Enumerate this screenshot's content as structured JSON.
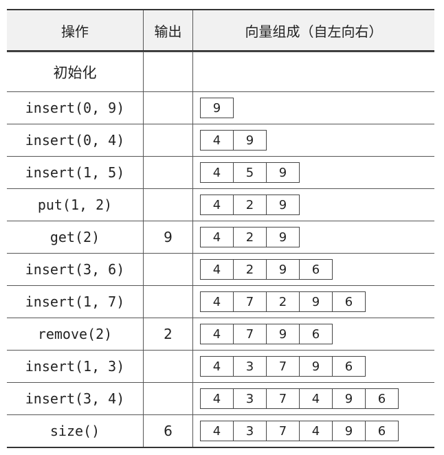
{
  "header": {
    "op": "操作",
    "output": "输出",
    "vector": "向量组成（自左向右）"
  },
  "rows": [
    {
      "op": "初始化",
      "output": "",
      "vector": []
    },
    {
      "op": "insert(0, 9)",
      "output": "",
      "vector": [
        "9"
      ]
    },
    {
      "op": "insert(0, 4)",
      "output": "",
      "vector": [
        "4",
        "9"
      ]
    },
    {
      "op": "insert(1, 5)",
      "output": "",
      "vector": [
        "4",
        "5",
        "9"
      ]
    },
    {
      "op": "put(1, 2)",
      "output": "",
      "vector": [
        "4",
        "2",
        "9"
      ]
    },
    {
      "op": "get(2)",
      "output": "9",
      "vector": [
        "4",
        "2",
        "9"
      ]
    },
    {
      "op": "insert(3, 6)",
      "output": "",
      "vector": [
        "4",
        "2",
        "9",
        "6"
      ]
    },
    {
      "op": "insert(1, 7)",
      "output": "",
      "vector": [
        "4",
        "7",
        "2",
        "9",
        "6"
      ]
    },
    {
      "op": "remove(2)",
      "output": "2",
      "vector": [
        "4",
        "7",
        "9",
        "6"
      ]
    },
    {
      "op": "insert(1, 3)",
      "output": "",
      "vector": [
        "4",
        "3",
        "7",
        "9",
        "6"
      ]
    },
    {
      "op": "insert(3, 4)",
      "output": "",
      "vector": [
        "4",
        "3",
        "7",
        "4",
        "9",
        "6"
      ]
    },
    {
      "op": "size()",
      "output": "6",
      "vector": [
        "4",
        "3",
        "7",
        "4",
        "9",
        "6"
      ]
    }
  ]
}
